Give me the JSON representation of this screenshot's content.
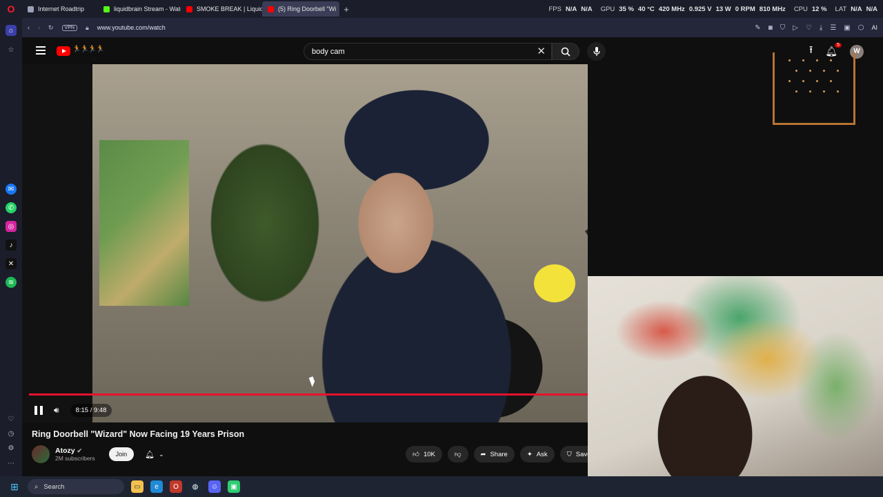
{
  "browser": {
    "tabs": [
      {
        "label": "Internet Roadtrip",
        "active": false
      },
      {
        "label": "liquidbrain Stream - Watc",
        "active": false
      },
      {
        "label": "SMOKE BREAK | Liquid Dr",
        "active": false
      },
      {
        "label": "(5) Ring Doorbell \"Wi",
        "active": true
      }
    ],
    "new_tab": "+",
    "url": "www.youtube.com/watch",
    "vpn_label": "VPN",
    "ai_label": "AI"
  },
  "hud": {
    "fps_label": "FPS",
    "fps_value1": "N/A",
    "fps_value2": "N/A",
    "gpu_label": "GPU",
    "gpu_usage": "35 %",
    "gpu_temp": "40 °C",
    "gpu_clock": "420 MHz",
    "gpu_voltage": "0.925 V",
    "gpu_power": "13 W",
    "gpu_fan": "0 RPM",
    "gpu_mem_clock": "810 MHz",
    "cpu_label": "CPU",
    "cpu_usage": "12 %",
    "lat_label": "LAT",
    "lat_value1": "N/A",
    "lat_value2": "N/A"
  },
  "youtube": {
    "search_query": "body cam",
    "notification_count": "5",
    "avatar_letter": "W",
    "player": {
      "time": "8:15 / 9:48",
      "progress_fraction": 0.842
    },
    "video_title": "Ring Doorbell \"Wizard\" Now Facing 19 Years Prison",
    "channel": {
      "name": "Atozy",
      "subscribers": "2M subscribers",
      "join_label": "Join"
    },
    "actions": {
      "like_count": "10K",
      "share_label": "Share",
      "ask_label": "Ask",
      "save_label": "Save"
    }
  },
  "taskbar": {
    "search_label": "Search"
  },
  "colors": {
    "accent_red": "#ff0000",
    "progress_red": "#e8112d",
    "browser_bg": "#1b1d2a"
  }
}
